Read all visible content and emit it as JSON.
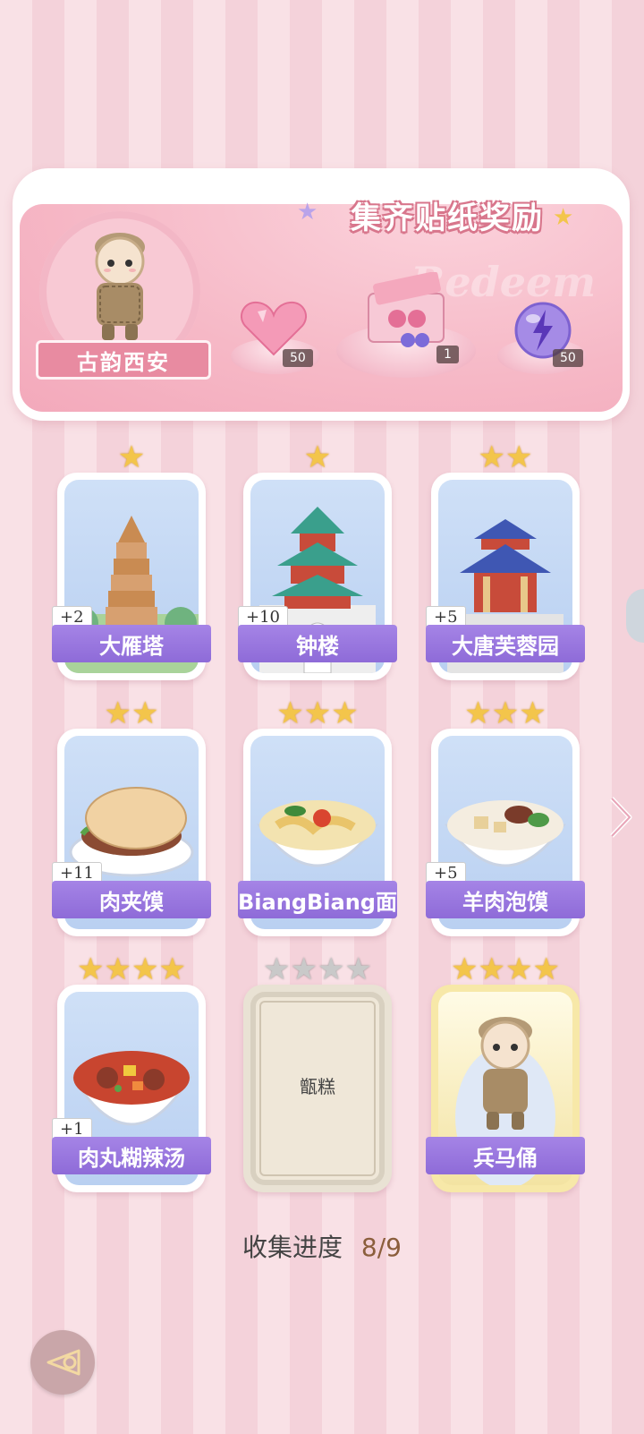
{
  "banner": {
    "title": "集齐贴纸奖励",
    "watermark": "Redeem",
    "region_name": "古韵西安",
    "rewards": [
      {
        "icon": "pink-heart-gem-icon",
        "count": "50"
      },
      {
        "icon": "gift-box-icon",
        "count": "1"
      },
      {
        "icon": "purple-lightning-orb-icon",
        "count": "50"
      }
    ]
  },
  "cards": [
    {
      "name": "大雁塔",
      "stars": 1,
      "bonus": "+2",
      "state": "collected",
      "icon": "wild-goose-pagoda-icon"
    },
    {
      "name": "钟楼",
      "stars": 1,
      "bonus": "+10",
      "state": "collected",
      "icon": "bell-tower-icon"
    },
    {
      "name": "大唐芙蓉园",
      "stars": 2,
      "bonus": "+5",
      "state": "collected",
      "icon": "pavilion-icon"
    },
    {
      "name": "肉夹馍",
      "stars": 2,
      "bonus": "+11",
      "state": "collected",
      "icon": "roujiamo-icon"
    },
    {
      "name": "BiangBiang面",
      "stars": 3,
      "bonus": "",
      "state": "collected",
      "icon": "noodle-bowl-icon"
    },
    {
      "name": "羊肉泡馍",
      "stars": 3,
      "bonus": "+5",
      "state": "collected",
      "icon": "mutton-soup-icon"
    },
    {
      "name": "肉丸糊辣汤",
      "stars": 4,
      "bonus": "+1",
      "state": "collected",
      "icon": "meatball-soup-icon"
    },
    {
      "name": "甑糕",
      "stars": 4,
      "bonus": "",
      "state": "locked",
      "icon": ""
    },
    {
      "name": "兵马俑",
      "stars": 4,
      "bonus": "",
      "state": "gold",
      "icon": "terracotta-warrior-icon"
    }
  ],
  "progress": {
    "label": "收集进度",
    "value": "8/9"
  },
  "colors": {
    "label_bar": "#9a78e0",
    "star_gold": "#f3c54b",
    "banner_pink": "#f6b8c6"
  }
}
